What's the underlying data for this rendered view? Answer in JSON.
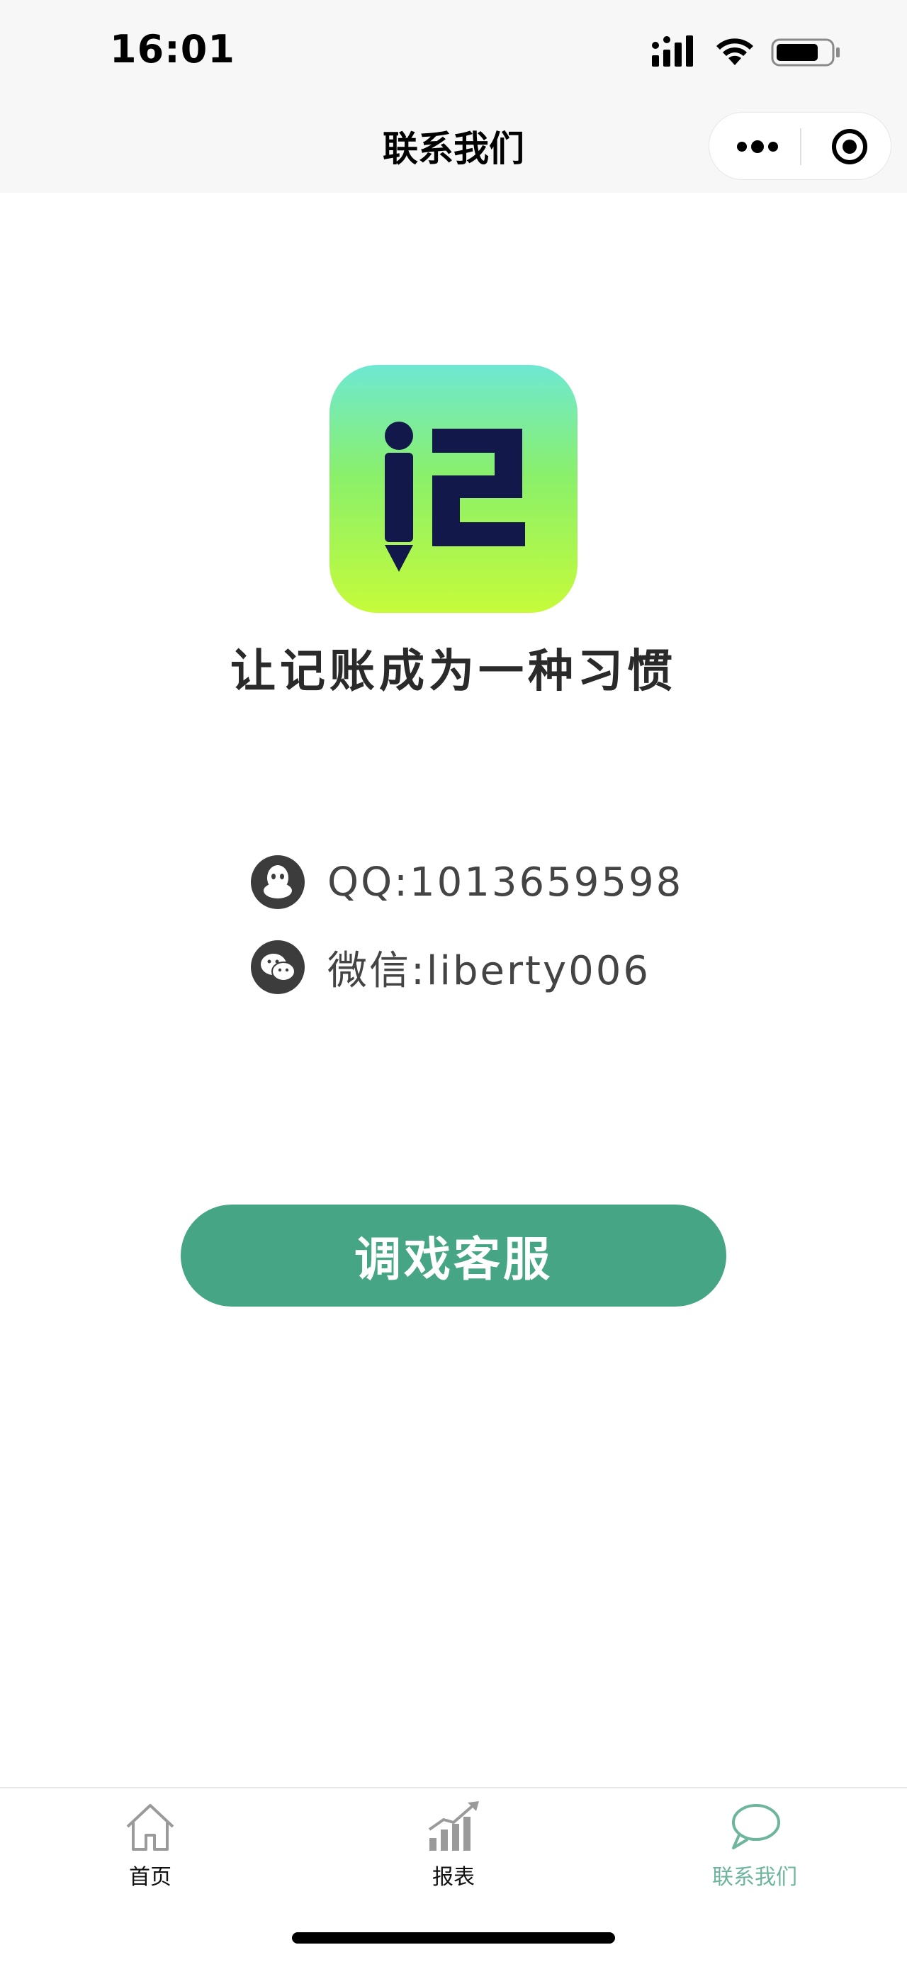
{
  "status_bar": {
    "time": "16:01",
    "icons": [
      "signal-icon",
      "wifi-icon",
      "battery-icon"
    ]
  },
  "nav": {
    "title": "联系我们",
    "capsule_icons": [
      "more-dots-icon",
      "close-target-icon"
    ]
  },
  "brand": {
    "logo_icon": "ji-pencil-logo",
    "slogan": "让记账成为一种习惯"
  },
  "contacts": [
    {
      "icon": "qq-icon",
      "text": "QQ:1013659598"
    },
    {
      "icon": "wechat-icon",
      "text": "微信:liberty006"
    }
  ],
  "cta": {
    "label": "调戏客服"
  },
  "tabbar": {
    "items": [
      {
        "icon": "home-icon",
        "label": "首页",
        "active": false
      },
      {
        "icon": "report-chart-icon",
        "label": "报表",
        "active": false
      },
      {
        "icon": "chat-bubble-icon",
        "label": "联系我们",
        "active": true
      }
    ]
  },
  "colors": {
    "accent": "#46a584",
    "tab_active": "#6db59c",
    "logo_gradient_top": "#6ee8d3",
    "logo_gradient_bottom": "#c6fb3a",
    "logo_glyph": "#13184a"
  }
}
